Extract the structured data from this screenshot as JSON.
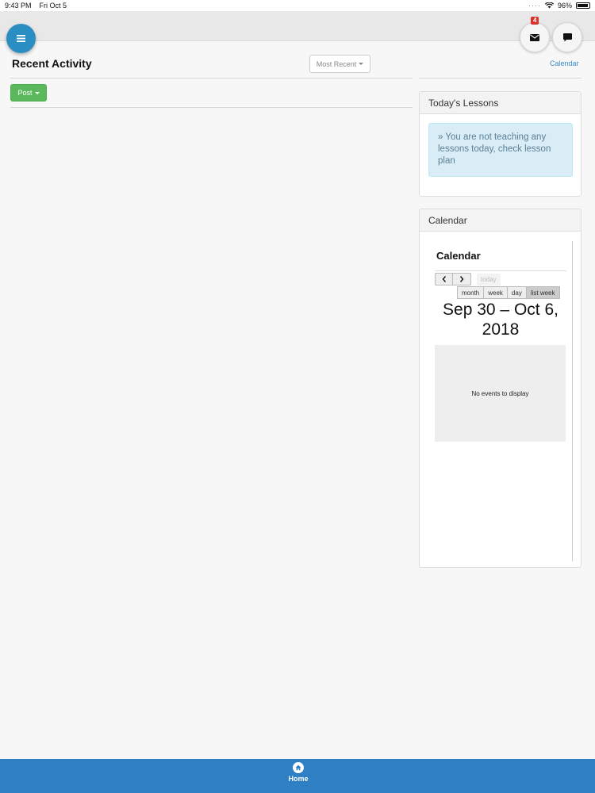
{
  "status_bar": {
    "time": "9:43 PM",
    "date": "Fri Oct 5",
    "battery": "96%"
  },
  "header": {
    "menu_icon": "hamburger-icon",
    "mail_icon": "envelope-icon",
    "chat_icon": "chat-bubble-icon",
    "mail_badge": "4",
    "badge_color": "#d9312a",
    "accent_color": "#2a8ec3"
  },
  "activity": {
    "title": "Recent Activity",
    "sort_label": "Most Recent",
    "post_label": "Post",
    "post_color": "#5cb85c"
  },
  "sidebar": {
    "calendar_link": "Calendar",
    "lessons": {
      "heading": "Today's Lessons",
      "message": "» You are not teaching any lessons today, check lesson plan"
    },
    "calendar": {
      "heading": "Calendar",
      "title": "Calendar",
      "today_label": "today",
      "views": [
        "month",
        "week",
        "day",
        "list week"
      ],
      "active_view": "list week",
      "range": "Sep 30 – Oct 6, 2018",
      "empty_message": "No events to display"
    }
  },
  "bottom_nav": {
    "home_label": "Home",
    "home_icon": "home-icon",
    "bar_color": "#2e7fc4"
  }
}
